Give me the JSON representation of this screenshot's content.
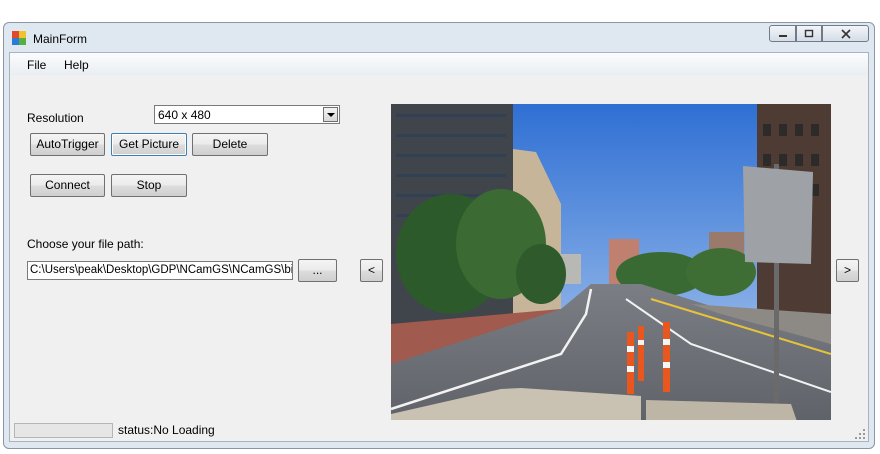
{
  "window": {
    "title": "MainForm"
  },
  "menu": {
    "items": [
      "File",
      "Help"
    ]
  },
  "controls": {
    "resolution_label": "Resolution",
    "resolution_value": "640 x 480",
    "autotrigger_label": "AutoTrigger",
    "get_picture_label": "Get Picture",
    "delete_label": "Delete",
    "connect_label": "Connect",
    "stop_label": "Stop",
    "path_label": "Choose your file path:",
    "path_value": "C:\\Users\\peak\\Desktop\\GDP\\NCamGS\\NCamGS\\bin",
    "browse_label": "...",
    "prev_label": "<",
    "next_label": ">"
  },
  "status": {
    "text": "status:No Loading",
    "progress": 0
  },
  "icons": [
    "app-icon",
    "minimize-icon",
    "maximize-icon",
    "close-icon",
    "resize-grip-icon"
  ]
}
